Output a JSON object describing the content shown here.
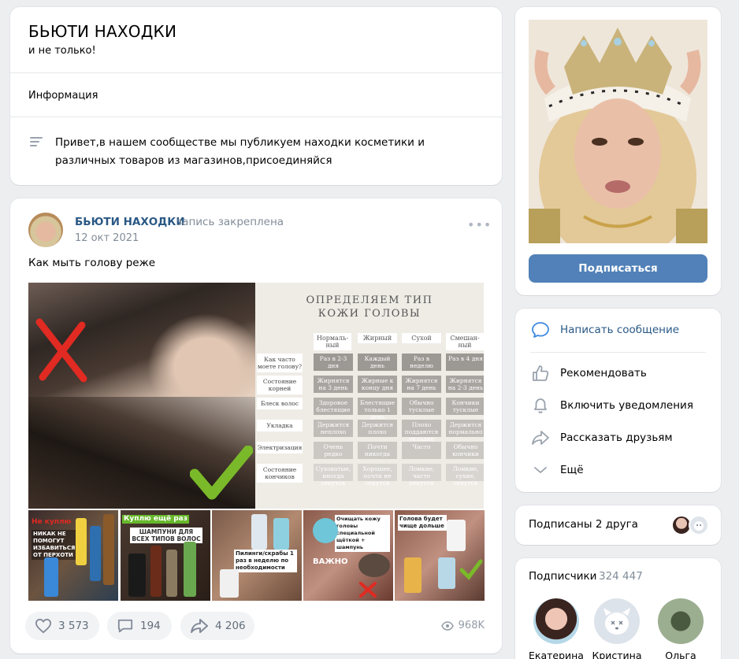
{
  "group": {
    "title": "БЬЮТИ НАХОДКИ",
    "subtitle": "и не только!",
    "info_tab": "Информация",
    "description": "Привет,в нашем сообществе мы публикуем находки косметики и различных товаров из магазинов,присоединяйся"
  },
  "post": {
    "author": "БЬЮТИ НАХОДКИ",
    "pinned_label": "запись закреплена",
    "date": "12 окт 2021",
    "text": "Как мыть голову реже",
    "image_table": {
      "title_line1": "ОПРЕДЕЛЯЕМ ТИП",
      "title_line2": "КОЖИ ГОЛОВЫ",
      "columns": [
        "Нормаль-ный",
        "Жирный",
        "Сухой",
        "Смешан-ный"
      ],
      "rows": [
        {
          "label": "Как часто моете голову?",
          "cells": [
            "Раз в 2-3 дня",
            "Каждый день",
            "Раз в неделю",
            "Раз в 4 дня"
          ]
        },
        {
          "label": "Состояние корней",
          "cells": [
            "Жирнятся на 3 день",
            "Жирные к концу дня",
            "Жирнятся на 7 день",
            "Жирнятся на 2-3 день"
          ]
        },
        {
          "label": "Блеск волос",
          "cells": [
            "Здоровое блестящие",
            "Блестящие только 1 день",
            "Обычно тусклые",
            "Кончики тусклые"
          ]
        },
        {
          "label": "Укладка",
          "cells": [
            "Держится неплохо",
            "Держится плохо",
            "Плохо поддаются укладке",
            "Держится нормально"
          ]
        },
        {
          "label": "Электризация",
          "cells": [
            "Очень редко",
            "Почти никогда",
            "Часто",
            "Обычно кончики"
          ]
        },
        {
          "label": "Состояние кончиков",
          "cells": [
            "Суховатые, иногда секутся",
            "Хорошее, почти не секутся",
            "Ломкие, часто секутся",
            "Ломкие, сухие, секутся"
          ]
        }
      ]
    },
    "thumb_labels": [
      "Не куплю",
      "Куплю ещё раз",
      "",
      "ВАЖНО",
      "Голова будет чище дольше"
    ],
    "thumb_texts": [
      "НИКАК НЕ ПОМОГУТ ИЗБАВИТЬСЯ ОТ ПЕРХОТИ",
      "ШАМПУНИ ДЛЯ ВСЕХ ТИПОВ ВОЛОС",
      "Пилинги/скрабы 1 раз в неделю по необходимости",
      "Очищать кожу головы специальной щёткой + шампунь",
      "Голова будет чище дольше"
    ],
    "likes": "3 573",
    "comments": "194",
    "shares": "4 206",
    "views": "968K"
  },
  "sidebar": {
    "subscribe_label": "Подписаться",
    "menu": [
      {
        "label": "Написать сообщение",
        "icon": "message-icon"
      },
      {
        "label": "Рекомендовать",
        "icon": "thumbs-up-icon"
      },
      {
        "label": "Включить уведомления",
        "icon": "bell-icon"
      },
      {
        "label": "Рассказать друзьям",
        "icon": "share-icon"
      },
      {
        "label": "Ещё",
        "icon": "chevron-down-icon"
      }
    ],
    "friends_label": "Подписаны 2 друга",
    "subscribers_label": "Подписчики",
    "subscribers_count": "324 447",
    "subscribers": [
      {
        "name": "Екатерина"
      },
      {
        "name": "Кристина"
      },
      {
        "name": "Ольга"
      }
    ]
  },
  "colors": {
    "accent": "#5181b8",
    "link": "#2a5885",
    "muted": "#818c99",
    "background": "#edeef0"
  }
}
